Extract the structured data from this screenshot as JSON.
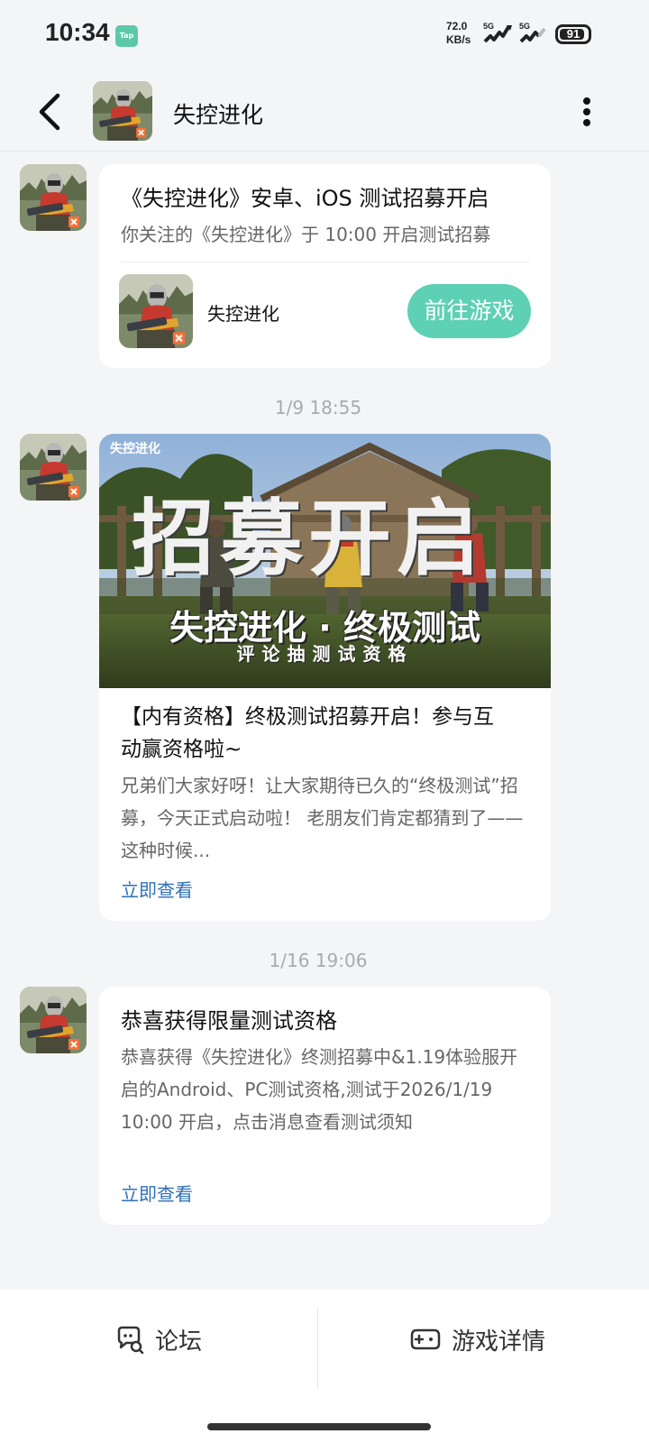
{
  "status_bar": {
    "time": "10:34",
    "app_badge": "Tap",
    "net_speed_value": "72.0",
    "net_speed_unit": "KB/s",
    "signal_label_1": "5G",
    "signal_label_2": "5G",
    "battery": "91"
  },
  "header": {
    "title": "失控进化",
    "back_icon": "chevron-left-icon",
    "more_icon": "more-vertical-icon"
  },
  "messages": [
    {
      "title": "《失控进化》安卓、iOS 测试招募开启",
      "desc": "你关注的《失控进化》于 10:00 开启测试招募",
      "game_name": "失控进化",
      "button_label": "前往游戏"
    },
    {
      "timestamp": "1/9  18:55",
      "banner_logo": "失控进化",
      "banner_headline": "招募开启",
      "banner_sub": "失控进化 · 终极测试",
      "banner_sub2": "评论抽测试资格",
      "title_line1": "【内有资格】终极测试招募开启！参与互",
      "title_line2": "动赢资格啦~",
      "desc": "兄弟们大家好呀！让大家期待已久的“终极测试”招募，今天正式启动啦！ 老朋友们肯定都猜到了——这种时候...",
      "link": "立即查看"
    },
    {
      "timestamp": "1/16  19:06",
      "title": "恭喜获得限量测试资格",
      "desc": "恭喜获得《失控进化》终测招募中&1.19体验服开启的Android、PC测试资格,测试于2026/1/19 10:00 开启，点击消息查看测试须知",
      "link": "立即查看"
    }
  ],
  "bottom_nav": {
    "forum": {
      "label": "论坛",
      "icon": "forum-chat-icon"
    },
    "game_detail": {
      "label": "游戏详情",
      "icon": "gamepad-icon"
    }
  },
  "colors": {
    "accent": "#5dd0b5",
    "link": "#2f6fb8",
    "background": "#f4f5f7"
  }
}
